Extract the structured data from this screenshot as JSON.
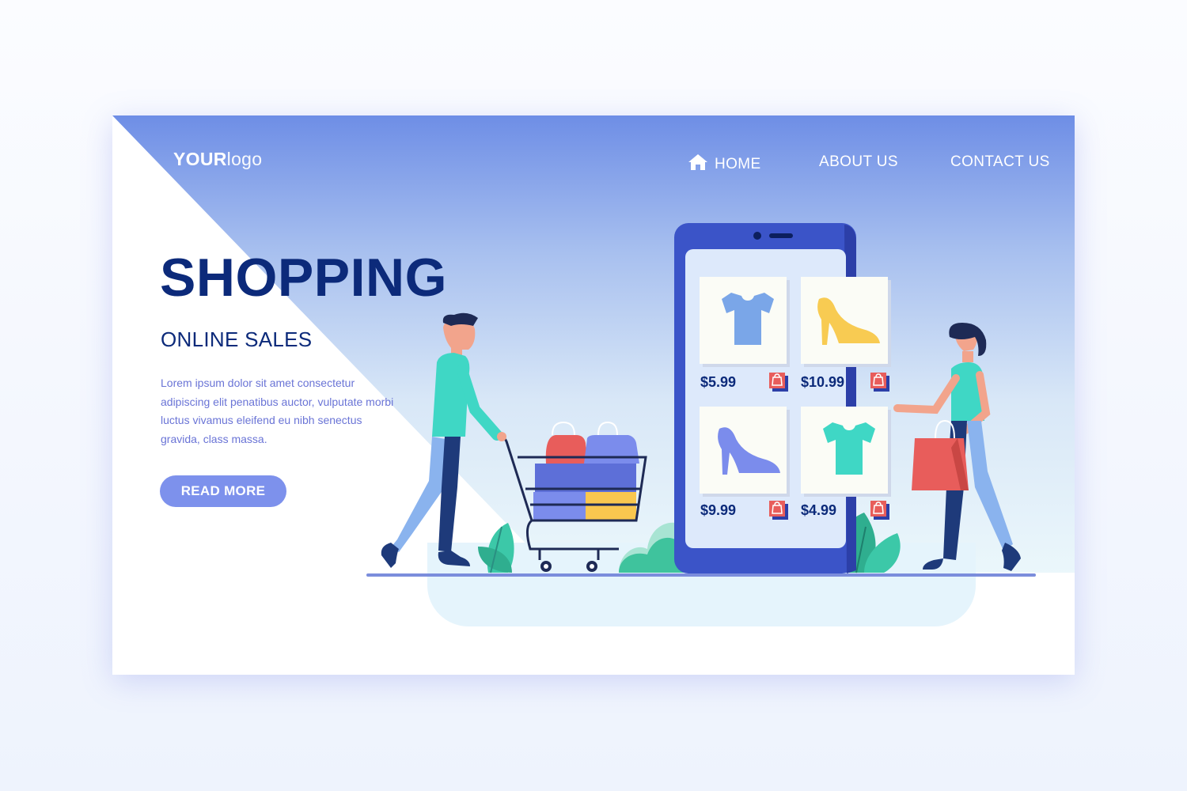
{
  "header": {
    "logo_bold": "YOUR",
    "logo_light": "logo",
    "nav": [
      {
        "label": "HOME",
        "icon": "home-icon"
      },
      {
        "label": "ABOUT US"
      },
      {
        "label": "CONTACT US"
      }
    ]
  },
  "hero": {
    "title": "SHOPPING",
    "subtitle": "ONLINE SALES",
    "body": "Lorem ipsum dolor sit amet consectetur adipiscing elit penatibus auctor, vulputate morbi luctus vivamus eleifend eu nibh senectus gravida, class massa.",
    "cta_label": "READ MORE"
  },
  "products": [
    {
      "item": "t-shirt",
      "price": "$5.99",
      "color": "#7aa6e8"
    },
    {
      "item": "high-heel shoe",
      "price": "$10.99",
      "color": "#f8cb52"
    },
    {
      "item": "high-heel shoe",
      "price": "$9.99",
      "color": "#7b8cec"
    },
    {
      "item": "t-shirt",
      "price": "$4.99",
      "color": "#3fd7c5"
    }
  ],
  "colors": {
    "navy": "#0c2a7a",
    "accent": "#7d91ec",
    "phone": "#3b54c8",
    "teal": "#3ed8c3",
    "red": "#e85d5b",
    "yellow": "#f9c74f"
  }
}
